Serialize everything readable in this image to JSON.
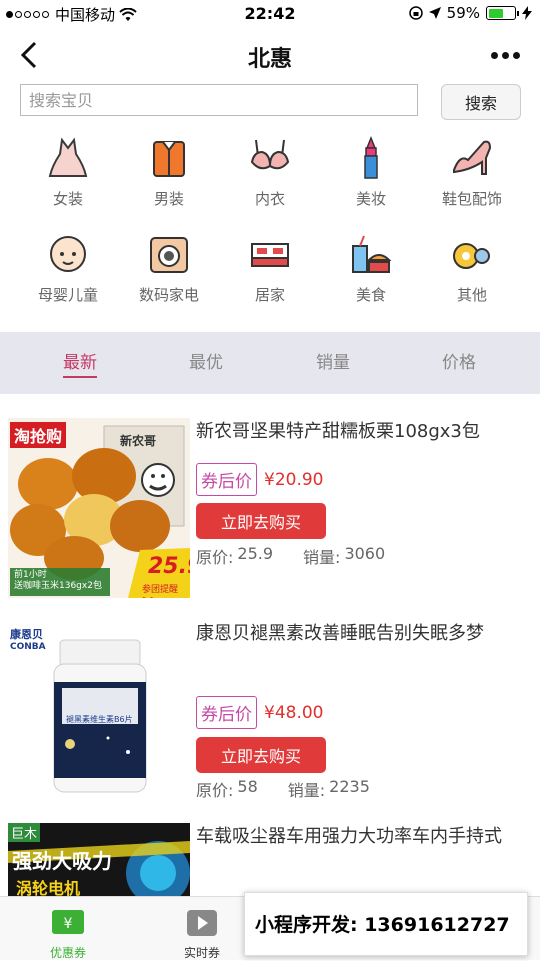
{
  "status_bar": {
    "carrier": "中国移动",
    "time": "22:42",
    "battery": "59%",
    "battery_level": 0.59
  },
  "nav": {
    "title": "北惠"
  },
  "search": {
    "placeholder": "搜索宝贝",
    "button_label": "搜索"
  },
  "categories": [
    {
      "label": "女装",
      "icon": "dress-icon"
    },
    {
      "label": "男装",
      "icon": "shirt-icon"
    },
    {
      "label": "内衣",
      "icon": "bra-icon"
    },
    {
      "label": "美妆",
      "icon": "lipstick-icon"
    },
    {
      "label": "鞋包配饰",
      "icon": "high-heel-icon"
    },
    {
      "label": "母婴儿童",
      "icon": "baby-icon"
    },
    {
      "label": "数码家电",
      "icon": "camera-icon"
    },
    {
      "label": "居家",
      "icon": "bed-icon"
    },
    {
      "label": "美食",
      "icon": "food-icon"
    },
    {
      "label": "其他",
      "icon": "other-icon"
    }
  ],
  "sort_tabs": [
    {
      "label": "最新",
      "active": true
    },
    {
      "label": "最优",
      "active": false
    },
    {
      "label": "销量",
      "active": false
    },
    {
      "label": "价格",
      "active": false
    }
  ],
  "products": [
    {
      "title": "新农哥坚果特产甜糯板栗108gx3包",
      "coupon_tag": "券后价",
      "price": "¥20.90",
      "buy_label": "立即去购买",
      "orig_label": "原价:",
      "orig_price": "25.9",
      "sales_label": "销量:",
      "sales": "3060",
      "image_texts": {
        "banner": "淘抢购",
        "brand": "新农哥",
        "promo_price": "25.9",
        "promo_line1": "前1小时",
        "promo_line2": "送咖啡玉米136gx2包",
        "promo_note": "参团提醒>>"
      }
    },
    {
      "title": "康恩贝褪黑素改善睡眠告别失眠多梦",
      "coupon_tag": "券后价",
      "price": "¥48.00",
      "buy_label": "立即去购买",
      "orig_label": "原价:",
      "orig_price": "58",
      "sales_label": "销量:",
      "sales": "2235",
      "image_texts": {
        "brand_cn": "康恩贝",
        "brand_en": "CONBA",
        "bottle_label": "褪黑素维生素B6片"
      }
    },
    {
      "title": "车载吸尘器车用强力大功率车内手持式",
      "image_texts": {
        "brand": "巨木",
        "headline": "强劲大吸力",
        "sub": "涡轮电机"
      }
    }
  ],
  "tabbar": [
    {
      "label": "优惠券",
      "icon": "coupon-icon",
      "active": true
    },
    {
      "label": "实时券",
      "icon": "tv-icon",
      "active": false
    }
  ],
  "popup": {
    "text": "小程序开发: 13691612727"
  },
  "colors": {
    "accent": "#c43a63",
    "buy_button": "#e03a3a",
    "price": "#e0302e",
    "coupon_border": "#c64aa5",
    "tab_active": "#3cb034"
  }
}
